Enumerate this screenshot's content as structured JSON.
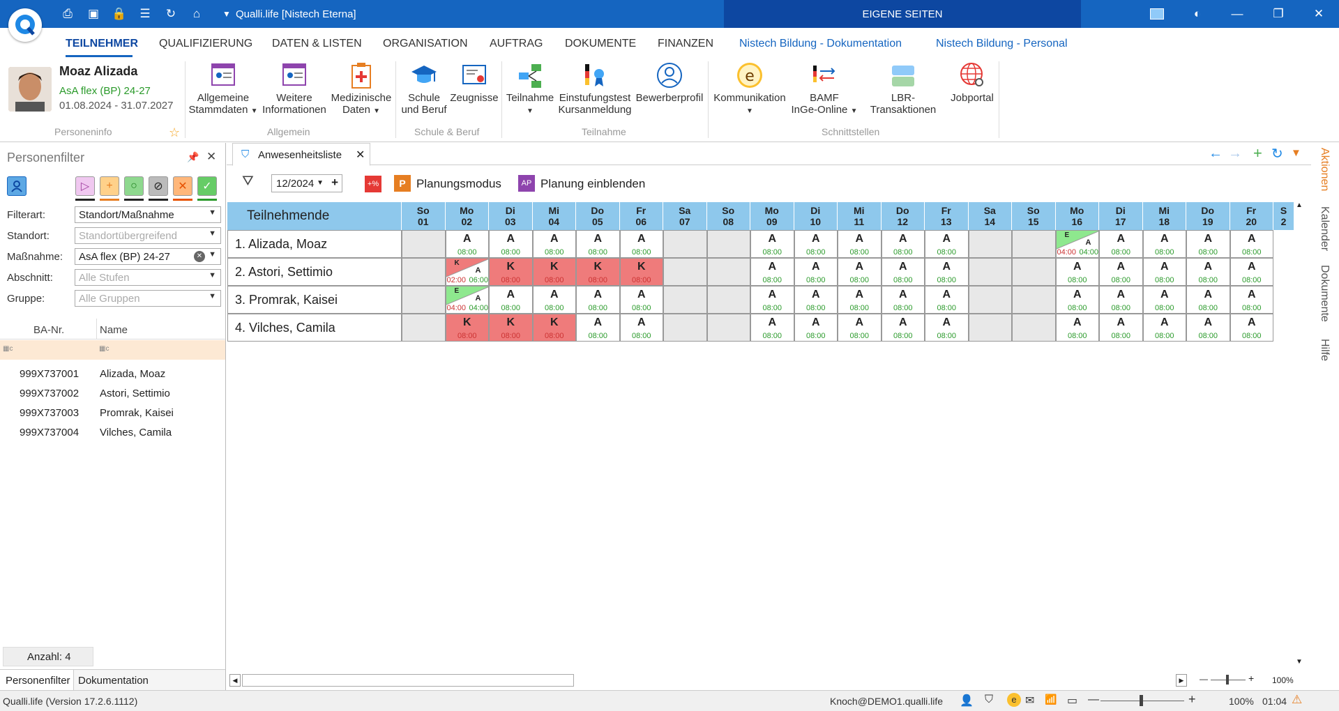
{
  "app": {
    "title": "Qualli.life [Nistech Eterna]",
    "eigene": "EIGENE SEITEN"
  },
  "menu": [
    "TEILNEHMER",
    "QUALIFIZIERUNG",
    "DATEN & LISTEN",
    "ORGANISATION",
    "AUFTRAG",
    "DOKUMENTE",
    "FINANZEN",
    "Nistech Bildung - Dokumentation",
    "Nistech Bildung - Personal"
  ],
  "person": {
    "name": "Moaz Alizada",
    "course": "AsA flex (BP) 24-27",
    "dates": "01.08.2024 - 31.07.2027",
    "group": "Personeninfo"
  },
  "ribbon": {
    "allgemein": {
      "label": "Allgemein",
      "b1": [
        "Allgemeine",
        "Stammdaten"
      ],
      "b2": [
        "Weitere",
        "Informationen"
      ],
      "b3": [
        "Medizinische",
        "Daten"
      ]
    },
    "schule": {
      "label": "Schule & Beruf",
      "b1": [
        "Schule",
        "und Beruf"
      ],
      "b2": "Zeugnisse"
    },
    "teilnahme": {
      "label": "Teilnahme",
      "b1": "Teilnahme",
      "b2": [
        "Einstufungstest",
        "Kursanmeldung"
      ],
      "b3": "Bewerberprofil"
    },
    "schnitt": {
      "label": "Schnittstellen",
      "b1": "Kommunikation",
      "b2": [
        "BAMF",
        "InGe-Online"
      ],
      "b3": "LBR-Transaktionen",
      "b4": "Jobportal"
    }
  },
  "filter": {
    "title": "Personenfilter",
    "rows": [
      {
        "label": "Filterart:",
        "value": "Standort/Maßnahme",
        "placeholder": false
      },
      {
        "label": "Standort:",
        "value": "Standortübergreifend",
        "placeholder": true
      },
      {
        "label": "Maßnahme:",
        "value": "AsA flex (BP) 24-27",
        "placeholder": false
      },
      {
        "label": "Abschnitt:",
        "value": "Alle Stufen",
        "placeholder": true
      },
      {
        "label": "Gruppe:",
        "value": "Alle Gruppen",
        "placeholder": true
      }
    ],
    "col_ba": "BA-Nr.",
    "col_name": "Name",
    "people": [
      [
        "999X737001",
        "Alizada, Moaz"
      ],
      [
        "999X737002",
        "Astori, Settimio"
      ],
      [
        "999X737003",
        "Promrak, Kaisei"
      ],
      [
        "999X737004",
        "Vilches, Camila"
      ]
    ],
    "count": "Anzahl: 4",
    "tabs": [
      "Personenfilter",
      "Dokumentation"
    ]
  },
  "tab": {
    "label": "Anwesenheitsliste"
  },
  "toolbar": {
    "month": "12/2024",
    "percent": "+%",
    "planung": "Planungsmodus",
    "planung_icon": "P",
    "einblenden": "Planung einblenden",
    "einblenden_icon": "AP"
  },
  "grid": {
    "header": "Teilnehmende",
    "days": [
      [
        "So",
        "01"
      ],
      [
        "Mo",
        "02"
      ],
      [
        "Di",
        "03"
      ],
      [
        "Mi",
        "04"
      ],
      [
        "Do",
        "05"
      ],
      [
        "Fr",
        "06"
      ],
      [
        "Sa",
        "07"
      ],
      [
        "So",
        "08"
      ],
      [
        "Mo",
        "09"
      ],
      [
        "Di",
        "10"
      ],
      [
        "Mi",
        "11"
      ],
      [
        "Do",
        "12"
      ],
      [
        "Fr",
        "13"
      ],
      [
        "Sa",
        "14"
      ],
      [
        "So",
        "15"
      ],
      [
        "Mo",
        "16"
      ],
      [
        "Di",
        "17"
      ],
      [
        "Mi",
        "18"
      ],
      [
        "Do",
        "19"
      ],
      [
        "Fr",
        "20"
      ],
      [
        "S",
        "2"
      ]
    ],
    "rows": [
      {
        "name": "1.  Alizada, Moaz",
        "cells": [
          "",
          "A",
          "A",
          "A",
          "A",
          "A",
          "",
          "",
          "A",
          "A",
          "A",
          "A",
          "A",
          "",
          "",
          "EA",
          "A",
          "A",
          "A",
          "A"
        ]
      },
      {
        "name": "2.  Astori, Settimio",
        "cells": [
          "",
          "KA",
          "K",
          "K",
          "K",
          "K",
          "",
          "",
          "A",
          "A",
          "A",
          "A",
          "A",
          "",
          "",
          "A",
          "A",
          "A",
          "A",
          "A"
        ]
      },
      {
        "name": "3.  Promrak, Kaisei",
        "cells": [
          "",
          "EA",
          "A",
          "A",
          "A",
          "A",
          "",
          "",
          "A",
          "A",
          "A",
          "A",
          "A",
          "",
          "",
          "A",
          "A",
          "A",
          "A",
          "A"
        ]
      },
      {
        "name": "4.  Vilches, Camila",
        "cells": [
          "",
          "K",
          "K",
          "K",
          "A",
          "A",
          "",
          "",
          "A",
          "A",
          "A",
          "A",
          "A",
          "",
          "",
          "A",
          "A",
          "A",
          "A",
          "A"
        ]
      }
    ],
    "time": "08:00",
    "split": {
      "KA": [
        "02:00",
        "06:00"
      ],
      "EA": [
        "04:00",
        "04:00"
      ]
    }
  },
  "side": [
    "Aktionen",
    "Kalender",
    "Dokumente",
    "Hilfe"
  ],
  "status": {
    "version": "Qualli.life (Version 17.2.6.1112)",
    "user": "Knoch@DEMO1.qualli.life",
    "zoom": "100%",
    "time": "01:04",
    "zoom2": "100%"
  }
}
